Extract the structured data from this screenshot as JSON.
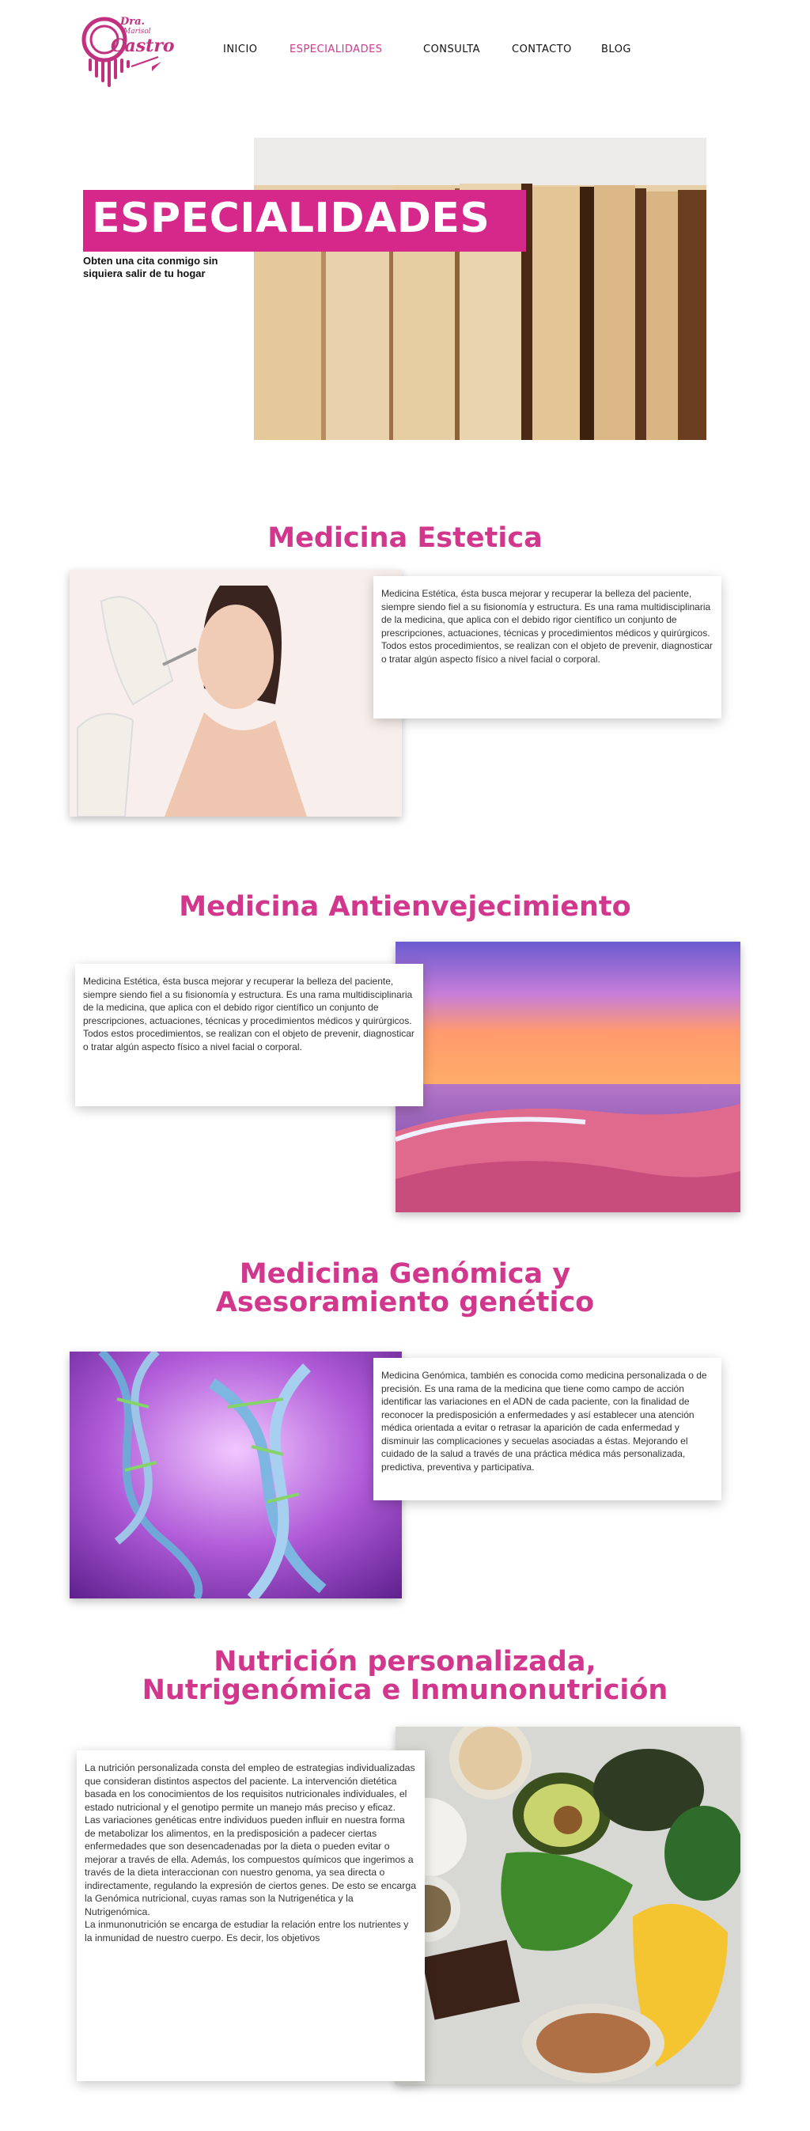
{
  "logo": {
    "line1": "Dra.",
    "line2": "Marisol",
    "line3": "Castro",
    "icon": "microphone-wave-logo"
  },
  "nav": {
    "items": [
      {
        "label": "INICIO"
      },
      {
        "label": "ESPECIALIDADES"
      },
      {
        "label": "CONSULTA"
      },
      {
        "label": "CONTACTO"
      },
      {
        "label": "BLOG"
      }
    ],
    "active_color": "#d1378c"
  },
  "hero": {
    "title": "ESPECIALIDADES",
    "subtitle": "Obten una cita conmigo sin siquiera salir de tu hogar",
    "image": "books-photo",
    "banner_color": "#d6278a"
  },
  "sections": [
    {
      "title": "Medicina Estetica",
      "image": "woman-injection-photo",
      "text": "Medicina Estética, ésta busca mejorar y recuperar la belleza del paciente, siempre siendo fiel a su fisionomía y estructura. Es una rama multidisciplinaria de la medicina, que aplica con el debido rigor científico un conjunto de prescripciones, actuaciones, técnicas y procedimientos médicos y quirúrgicos. Todos estos procedimientos, se realizan con el objeto de prevenir, diagnosticar o tratar algún aspecto físico a nivel facial o corporal."
    },
    {
      "title": "Medicina Antienvejecimiento",
      "image": "beach-sunset-photo",
      "text": "Medicina Estética, ésta busca mejorar y recuperar la belleza del paciente, siempre siendo fiel a su fisionomía y estructura. Es una rama multidisciplinaria de la medicina, que aplica con el debido rigor científico un conjunto de prescripciones, actuaciones, técnicas y procedimientos médicos y quirúrgicos. Todos estos procedimientos, se realizan con el objeto de prevenir, diagnosticar o tratar algún aspecto físico a nivel facial o corporal."
    },
    {
      "title_line1": "Medicina Genómica y",
      "title_line2": "Asesoramiento genético",
      "image": "dna-helix-photo",
      "text": "Medicina Genómica, también es conocida como medicina personalizada o de precisión. Es una rama de la medicina que tiene como campo de acción identificar las variaciones en el ADN de cada paciente, con la finalidad de reconocer la predisposición a enfermedades y así establecer una atención médica orientada a evitar o retrasar la aparición de cada enfermedad y disminuir las complicaciones y secuelas asociadas a éstas. Mejorando el cuidado de la salud a través de una práctica médica más personalizada, predictiva, preventiva y participativa."
    },
    {
      "title_line1": "Nutrición personalizada,",
      "title_line2": "Nutrigenómica e Inmunonutrición",
      "image": "healthy-food-photo",
      "paragraphs": [
        "La nutrición personalizada consta del empleo de estrategias individualizadas que consideran distintos aspectos del paciente. La intervención dietética basada en los conocimientos de los requisitos nutricionales individuales, el estado nutricional y el genotipo permite un manejo más preciso y eficaz.",
        "Las variaciones genéticas entre individuos pueden influir en nuestra forma de metabolizar los alimentos, en la predisposición a padecer ciertas enfermedades que son desencadenadas por la dieta o pueden evitar o mejorar a través de ella. Además, los compuestos químicos que ingerimos a través de la dieta interaccionan con nuestro genoma, ya sea directa o indirectamente, regulando la expresión de ciertos genes. De esto se encarga la Genómica nutricional, cuyas ramas son la Nutrigenética y la Nutrigenómica.",
        "La inmunonutrición se encarga de estudiar la relación entre los nutrientes y la inmunidad de nuestro cuerpo. Es decir, los objetivos"
      ]
    }
  ]
}
